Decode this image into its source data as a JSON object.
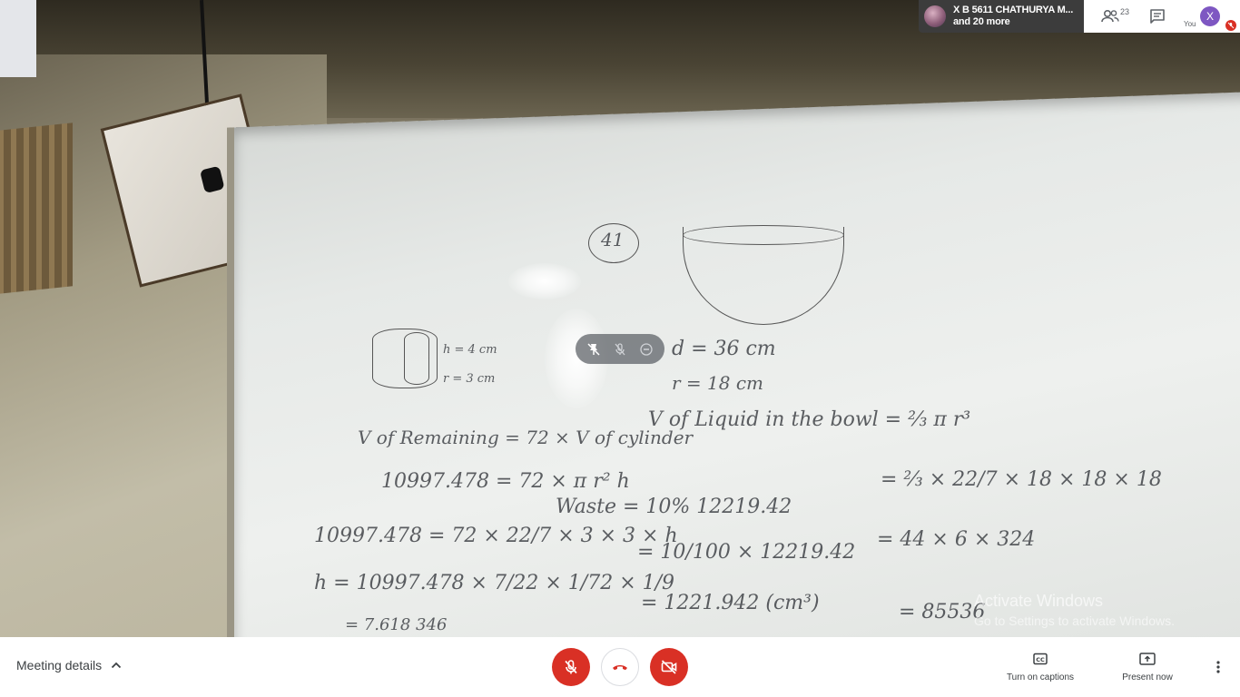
{
  "meeting": {
    "participants_summary_line1": "X B 5611 CHATHURYA M...",
    "participants_summary_line2": "and 20 more",
    "participant_count": "23",
    "self_label": "You",
    "self_initial": "X"
  },
  "bottom_bar": {
    "meeting_details_label": "Meeting details",
    "captions_label": "Turn on captions",
    "present_label": "Present now"
  },
  "watermark": {
    "title": "Activate Windows",
    "subtitle": "Go to Settings to activate Windows."
  },
  "colors": {
    "danger": "#d93025",
    "avatar": "#7e57c2",
    "bar_background": "#ffffff",
    "card_dark": "#3c3c3c"
  },
  "icons": [
    "people-icon",
    "chat-icon",
    "mic-off-icon",
    "hangup-icon",
    "camera-off-icon",
    "captions-icon",
    "present-icon",
    "more-vert-icon",
    "pin-icon",
    "mute-participant-icon",
    "remove-participant-icon",
    "chevron-up-icon"
  ]
}
